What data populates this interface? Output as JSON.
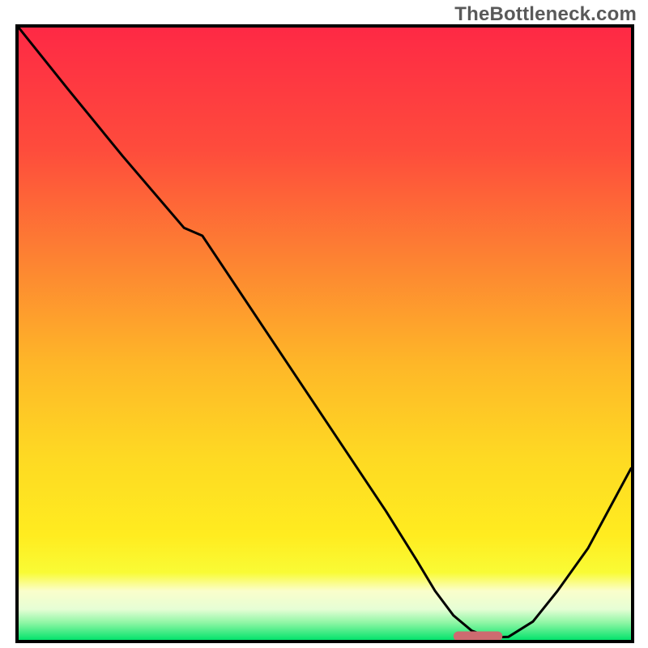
{
  "watermark": "TheBottleneck.com",
  "chart_data": {
    "type": "line",
    "title": "",
    "xlabel": "",
    "ylabel": "",
    "xlim": [
      0,
      100
    ],
    "ylim": [
      0,
      100
    ],
    "grid": false,
    "legend": false,
    "colors": {
      "gradient_top": "#fe2945",
      "gradient_mid_upper": "#fd8332",
      "gradient_mid": "#fed923",
      "gradient_lower": "#f9fb35",
      "gradient_band": "#fafecb",
      "gradient_bottom": "#04e36c",
      "marker": "#cd6b70",
      "curve": "#000000",
      "frame": "#000000"
    },
    "series": [
      {
        "name": "bottleneck-curve",
        "x": [
          0,
          8,
          17,
          27,
          30,
          40,
          50,
          60,
          65,
          68,
          71,
          74,
          77,
          80,
          84,
          88,
          93,
          100
        ],
        "y": [
          100,
          90,
          79,
          67.3,
          66,
          51,
          36,
          21,
          13,
          8,
          4,
          1.5,
          0.4,
          0.5,
          3,
          8,
          15,
          28
        ]
      }
    ],
    "marker": {
      "name": "optimal-range",
      "shape": "rounded-bar",
      "x_range": [
        71,
        79
      ],
      "y": 0.6,
      "color": "#cd6b70"
    }
  }
}
